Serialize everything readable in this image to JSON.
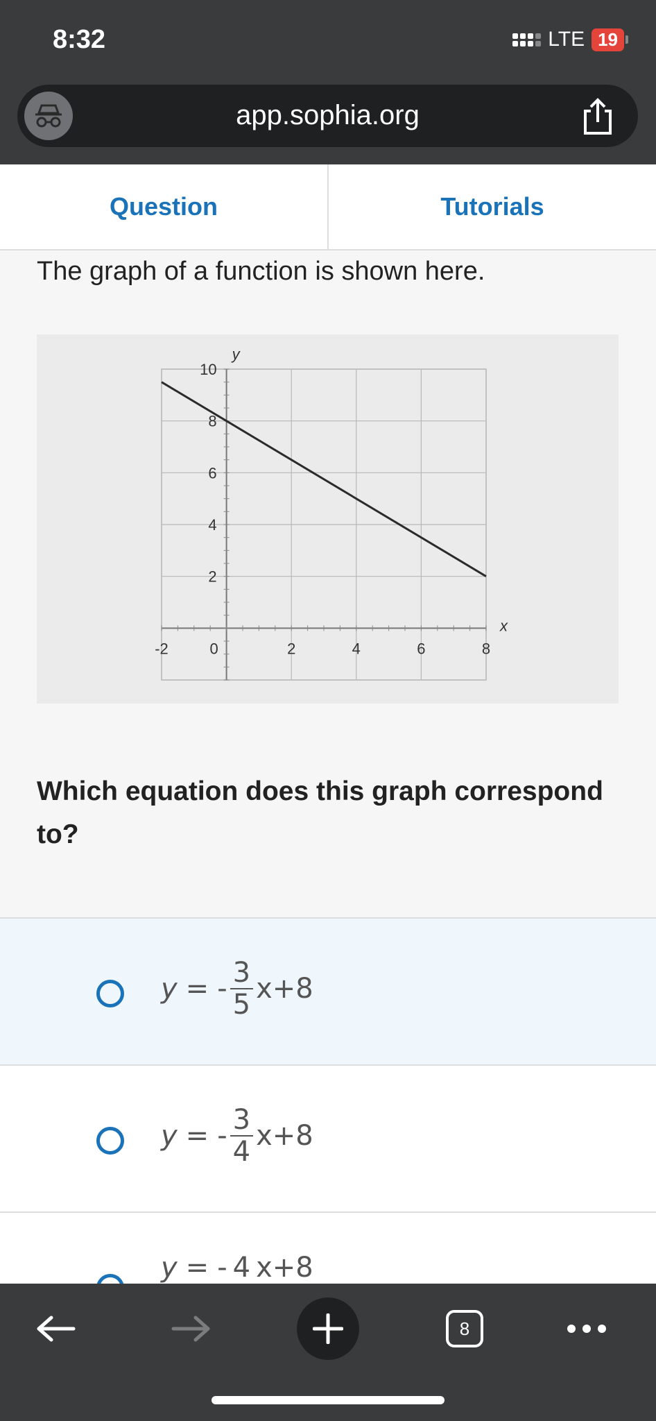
{
  "status_bar": {
    "time": "8:32",
    "network": "LTE",
    "battery": "19"
  },
  "browser": {
    "url": "app.sophia.org",
    "tab_count": "8"
  },
  "tabs": [
    {
      "label": "Question"
    },
    {
      "label": "Tutorials"
    }
  ],
  "question": {
    "intro": "The graph of a function is shown here.",
    "prompt": "Which equation does this graph correspond to?"
  },
  "options": [
    {
      "lhs": "y",
      "equals": "=",
      "sign": "-",
      "num": "3",
      "den": "5",
      "rest": "x+8"
    },
    {
      "lhs": "y",
      "equals": "=",
      "sign": "-",
      "num": "3",
      "den": "4",
      "rest": "x+8"
    },
    {
      "lhs": "y",
      "equals": "=",
      "sign": "-",
      "num": "4",
      "den": "",
      "rest": "x+8"
    }
  ],
  "chart_data": {
    "type": "line",
    "xlabel": "x",
    "ylabel": "y",
    "xlim": [
      -2,
      8
    ],
    "ylim": [
      -2,
      10
    ],
    "xticks": [
      "-2",
      "0",
      "2",
      "4",
      "6",
      "8"
    ],
    "yticks": [
      "2",
      "4",
      "6",
      "8",
      "10"
    ],
    "grid": true,
    "series": [
      {
        "x": [
          -2,
          8
        ],
        "y": [
          9.5,
          2
        ]
      }
    ],
    "colors": {
      "line": "#2b2b2b",
      "grid": "#b8b8b8",
      "background": "#ebebeb"
    }
  }
}
